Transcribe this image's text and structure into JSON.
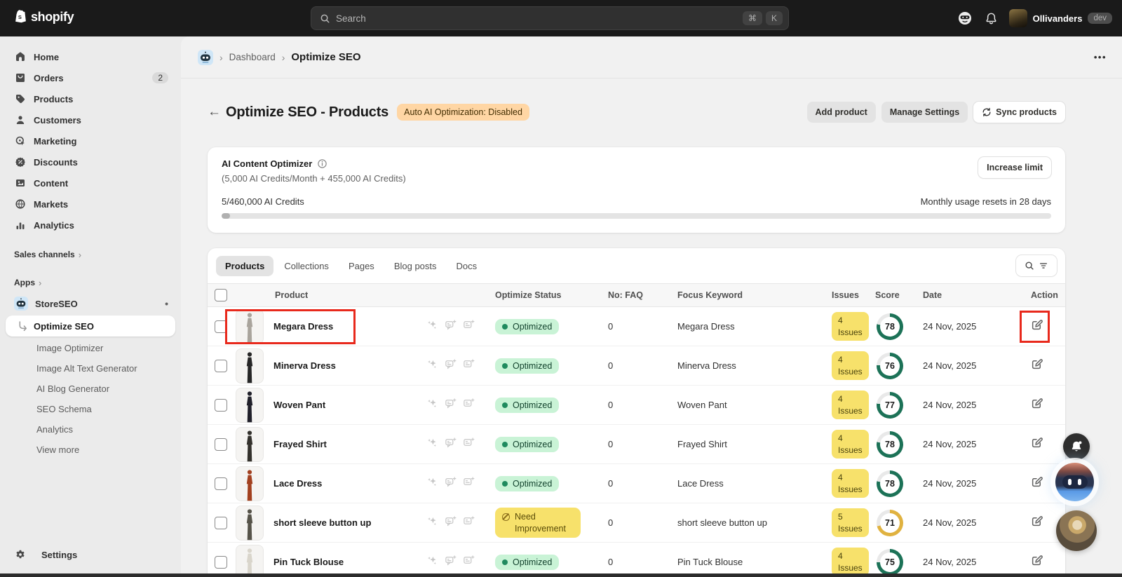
{
  "topbar": {
    "brand": "shopify",
    "search_placeholder": "Search",
    "shortcut_cmd": "⌘",
    "shortcut_k": "K",
    "user_name": "Ollivanders",
    "user_badge": "dev"
  },
  "icons": {
    "back": "←",
    "chevron": "›",
    "more": "•••",
    "dot": "•"
  },
  "sidebar": {
    "items": [
      {
        "label": "Home"
      },
      {
        "label": "Orders",
        "badge": "2"
      },
      {
        "label": "Products"
      },
      {
        "label": "Customers"
      },
      {
        "label": "Marketing"
      },
      {
        "label": "Discounts"
      },
      {
        "label": "Content"
      },
      {
        "label": "Markets"
      },
      {
        "label": "Analytics"
      }
    ],
    "sales_channels": "Sales channels",
    "apps": "Apps",
    "app_name": "StoreSEO",
    "app_items": [
      {
        "label": "Optimize SEO"
      },
      {
        "label": "Image Optimizer"
      },
      {
        "label": "Image Alt Text Generator"
      },
      {
        "label": "AI Blog Generator"
      },
      {
        "label": "SEO Schema"
      },
      {
        "label": "Analytics"
      },
      {
        "label": "View more"
      }
    ],
    "settings": "Settings"
  },
  "breadcrumb": {
    "items": [
      "Dashboard",
      "Optimize SEO"
    ]
  },
  "page": {
    "title": "Optimize SEO - Products",
    "auto_ai_badge": "Auto AI Optimization: Disabled",
    "add_product": "Add product",
    "manage_settings": "Manage Settings",
    "sync_products": "Sync products"
  },
  "credits": {
    "title": "AI Content Optimizer",
    "subtitle": "(5,000 AI Credits/Month + 455,000 AI Credits)",
    "usage": "5/460,000 AI Credits",
    "increase_limit": "Increase limit",
    "reset_note": "Monthly usage resets in 28 days",
    "progress_percent": 1
  },
  "table": {
    "tabs": [
      "Products",
      "Collections",
      "Pages",
      "Blog posts",
      "Docs"
    ],
    "active_tab": "Products",
    "columns": [
      "Product",
      "Optimize Status",
      "No: FAQ",
      "Focus Keyword",
      "Issues",
      "Score",
      "Date",
      "Action"
    ],
    "issues_word": "Issues",
    "rows": [
      {
        "name": "Megara Dress",
        "status": "Optimized",
        "status_type": "success",
        "faq": "0",
        "keyword": "Megara Dress",
        "issues": "4",
        "score": 78,
        "score_color": "#1c7257",
        "date": "24 Nov, 2025",
        "thumb_color": "#a9a49c",
        "highlighted": true
      },
      {
        "name": "Minerva Dress",
        "status": "Optimized",
        "status_type": "success",
        "faq": "0",
        "keyword": "Minerva Dress",
        "issues": "4",
        "score": 76,
        "score_color": "#1c7257",
        "date": "24 Nov, 2025",
        "thumb_color": "#262626",
        "highlighted": false
      },
      {
        "name": "Woven Pant",
        "status": "Optimized",
        "status_type": "success",
        "faq": "0",
        "keyword": "Woven Pant",
        "issues": "4",
        "score": 77,
        "score_color": "#1c7257",
        "date": "24 Nov, 2025",
        "thumb_color": "#20202a",
        "highlighted": false
      },
      {
        "name": "Frayed Shirt",
        "status": "Optimized",
        "status_type": "success",
        "faq": "0",
        "keyword": "Frayed Shirt",
        "issues": "4",
        "score": 78,
        "score_color": "#1c7257",
        "date": "24 Nov, 2025",
        "thumb_color": "#33312c",
        "highlighted": false
      },
      {
        "name": "Lace Dress",
        "status": "Optimized",
        "status_type": "success",
        "faq": "0",
        "keyword": "Lace Dress",
        "issues": "4",
        "score": 78,
        "score_color": "#1c7257",
        "date": "24 Nov, 2025",
        "thumb_color": "#a2401f",
        "highlighted": false
      },
      {
        "name": "short sleeve button up",
        "status": "Need Improvement",
        "status_type": "warning",
        "faq": "0",
        "keyword": "short sleeve button up",
        "issues": "5",
        "score": 71,
        "score_color": "#e0b240",
        "date": "24 Nov, 2025",
        "thumb_color": "#565349",
        "highlighted": false
      },
      {
        "name": "Pin Tuck Blouse",
        "status": "Optimized",
        "status_type": "success",
        "faq": "0",
        "keyword": "Pin Tuck Blouse",
        "issues": "4",
        "score": 75,
        "score_color": "#1c7257",
        "date": "24 Nov, 2025",
        "thumb_color": "#d9d5cb",
        "highlighted": false
      }
    ]
  },
  "floating_buttons": [
    "notifications",
    "ai-assistant",
    "support-avatar"
  ],
  "colors": {
    "topbar_bg": "#1a1a1a",
    "sidebar_bg": "#ebebeb",
    "main_bg": "#f1f1f1",
    "success_bg": "#c9f3d6",
    "success_dot": "#1f8a5e",
    "warning_bg": "#f7e16b",
    "caution_badge_bg": "#ffd6a4",
    "score_green": "#1c7257",
    "score_yellow": "#e0b240",
    "annotation_red": "#e8291c"
  }
}
